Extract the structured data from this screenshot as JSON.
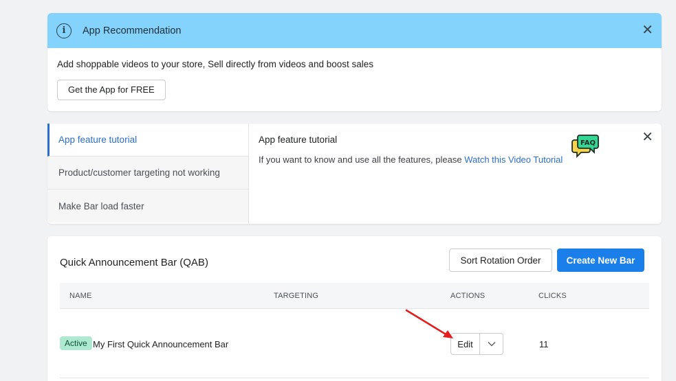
{
  "banner": {
    "title": "App Recommendation",
    "text": "Add shoppable videos to your store, Sell directly from videos and boost sales",
    "button_label": "Get the App for FREE",
    "close_label": "✕",
    "info_glyph": "i",
    "icon": "info-icon"
  },
  "faq": {
    "tabs": [
      {
        "label": "App feature tutorial",
        "active": true
      },
      {
        "label": "Product/customer targeting not working",
        "active": false
      },
      {
        "label": "Make Bar load faster",
        "active": false
      }
    ],
    "content_title": "App feature tutorial",
    "content_text": "If you want to know and use all the features, please ",
    "content_link": "Watch this Video Tutorial",
    "illustration_label": "FAQ",
    "close_label": "✕"
  },
  "qab": {
    "title": "Quick Announcement Bar (QAB)",
    "sort_button": "Sort Rotation Order",
    "create_button": "Create New Bar",
    "columns": [
      "NAME",
      "TARGETING",
      "ACTIONS",
      "CLICKS"
    ],
    "rows": [
      {
        "status": "Active",
        "name": "My First Quick Announcement Bar",
        "targeting": "",
        "action": "Edit",
        "clicks": "11"
      }
    ]
  },
  "colors": {
    "banner_bg": "#83d3fc",
    "primary": "#1a7fe8",
    "link": "#2c6ecb",
    "badge_bg": "#aee9d1",
    "arrow": "#e41e1e"
  }
}
